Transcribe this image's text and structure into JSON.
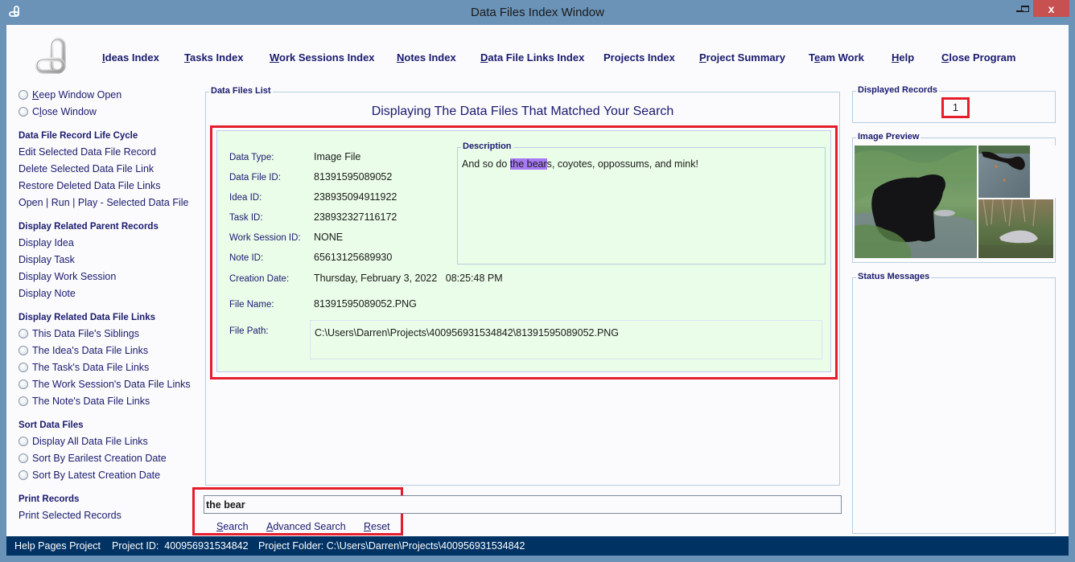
{
  "window": {
    "title": "Data Files Index Window",
    "controls": {
      "minimize": "‒",
      "maximize": "☐",
      "close": "x"
    }
  },
  "nav": {
    "items": [
      {
        "mnemonic": "I",
        "rest": "deas Index"
      },
      {
        "mnemonic": "T",
        "rest": "asks Index"
      },
      {
        "mnemonic": "W",
        "rest": "ork Sessions Index"
      },
      {
        "mnemonic": "N",
        "rest": "otes Index"
      },
      {
        "mnemonic": "D",
        "rest": "ata File Links Index"
      },
      {
        "mnemonic": "",
        "rest": "Projects Index"
      },
      {
        "mnemonic": "P",
        "rest": "roject Summary"
      },
      {
        "pre": "T",
        "mnemonic": "e",
        "rest": "am Work"
      },
      {
        "mnemonic": "H",
        "rest": "elp"
      },
      {
        "mnemonic": "C",
        "rest": "lose Program"
      }
    ]
  },
  "sidebar": {
    "window_options": [
      {
        "pre": "",
        "mnemonic": "K",
        "rest": "eep Window Open"
      },
      {
        "pre": "C",
        "mnemonic": "l",
        "rest": "ose Window"
      }
    ],
    "life_cycle": {
      "heading": "Data File Record Life Cycle",
      "items": [
        "Edit Selected Data File Record",
        "Delete Selected Data File Link",
        "Restore Deleted Data File Links",
        "Open | Run | Play - Selected Data File"
      ]
    },
    "parent_records": {
      "heading": "Display Related Parent Records",
      "items": [
        "Display Idea",
        "Display Task",
        "Display Work Session",
        "Display Note"
      ]
    },
    "related_links": {
      "heading": "Display Related Data File Links",
      "items": [
        "This Data File's Siblings",
        "The Idea's Data File Links",
        "The Task's Data File Links",
        "The Work Session's Data File Links",
        "The Note's Data File Links"
      ]
    },
    "sort": {
      "heading": "Sort Data Files",
      "items": [
        "Display All Data File Links",
        "Sort By Earilest Creation Date",
        "Sort By Latest Creation Date"
      ]
    },
    "print": {
      "heading": "Print Records",
      "items": [
        "Print Selected Records"
      ]
    }
  },
  "files_list": {
    "legend": "Data Files List",
    "heading": "Displaying The Data Files That Matched Your Search",
    "record": {
      "data_type_label": "Data Type:",
      "data_type": "Image File",
      "data_file_id_label": "Data File ID:",
      "data_file_id": "81391595089052",
      "idea_id_label": "Idea ID:",
      "idea_id": "238935094911922",
      "task_id_label": "Task ID:",
      "task_id": "238932327116172",
      "work_session_id_label": "Work Session ID:",
      "work_session_id": "NONE",
      "note_id_label": "Note ID:",
      "note_id": "65613125689930",
      "creation_date_label": "Creation Date:",
      "creation_date": "Thursday, February 3, 2022   08:25:48 PM",
      "file_name_label": "File Name:",
      "file_name": "81391595089052.PNG",
      "file_path_label": "File Path:",
      "file_path": "C:\\Users\\Darren\\Projects\\400956931534842\\81391595089052.PNG",
      "description_legend": "Description",
      "description_before": "And so do ",
      "description_highlight": "the bear",
      "description_after": "s, coyotes, oppossums, and mink!"
    }
  },
  "search": {
    "value": "the bear",
    "buttons": [
      {
        "mnemonic": "S",
        "rest": "earch"
      },
      {
        "mnemonic": "A",
        "rest": "dvanced Search"
      },
      {
        "mnemonic": "R",
        "rest": "eset"
      }
    ]
  },
  "right_panel": {
    "records_legend": "Displayed Records",
    "records_count": "1",
    "preview_legend": "Image Preview",
    "preview_alt": "Collage: black bear at a bowl, mink on a rock, opossum in grass",
    "status_legend": "Status Messages",
    "status_messages": []
  },
  "statusbar": {
    "project_name": "Help Pages Project",
    "project_id": "Project ID:  400956931534842",
    "project_folder": "Project Folder: C:\\Users\\Darren\\Projects\\400956931534842"
  },
  "colors": {
    "title_bar": "#6b93b8",
    "close_button": "#c75050",
    "nav_text": "#1a1a6e",
    "record_bg": "#eafde8",
    "highlight": "#a77af4",
    "callout": "#e41e2b",
    "status_bar": "#003264"
  }
}
